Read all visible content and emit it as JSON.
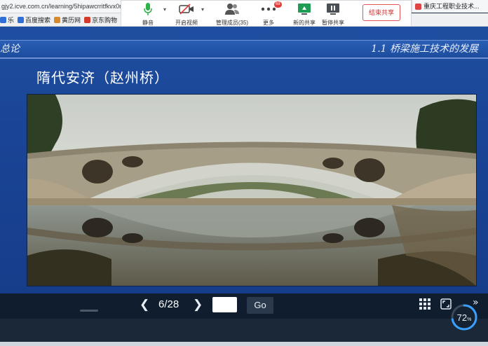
{
  "browser": {
    "url": "gjy2.icve.com.cn/learning/5hipawcrritfkvx0r",
    "bookmarks": [
      {
        "label": "乐",
        "color": "#2f6fd6"
      },
      {
        "label": "百度搜索",
        "color": "#2f6fd6"
      },
      {
        "label": "黄历网",
        "color": "#d88a2a"
      },
      {
        "label": "京东购物",
        "color": "#d33a2a"
      }
    ],
    "right_tab": "重庆工程职业技术..."
  },
  "meeting_toolbar": {
    "mute": "静音",
    "video": "开启视频",
    "members": "管理成员(35)",
    "more": "更多",
    "more_badge": "68",
    "new_share": "新的共享",
    "pause_share": "暂停共享",
    "end_share": "结束共享"
  },
  "slide": {
    "header_left": "总论",
    "header_right": "1.1  桥梁施工技术的发展",
    "title": "隋代安济（赵州桥）"
  },
  "player": {
    "current_page": "6",
    "total_pages": "28",
    "page_display": "6/28",
    "page_input_value": "",
    "go_label": "Go",
    "progress_percent": 72,
    "progress_label": "72",
    "progress_unit": "%"
  },
  "colors": {
    "slide_blue": "#1f4fa0",
    "player_bg": "#0f1d2e",
    "end_share_red": "#d23030"
  }
}
